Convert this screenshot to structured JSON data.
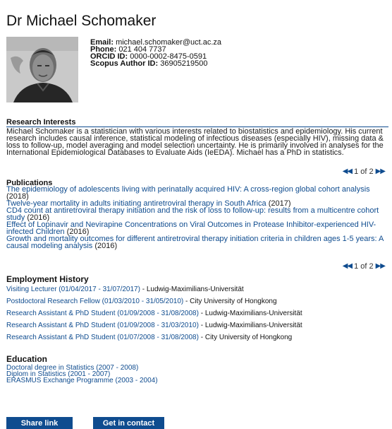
{
  "profile": {
    "name": "Dr Michael Schomaker",
    "email_label": "Email:",
    "email": "michael.schomaker@uct.ac.za",
    "phone_label": "Phone:",
    "phone": "021 404 7737",
    "orcid_label": "ORCID ID:",
    "orcid": "0000-0002-8475-0591",
    "scopus_label": "Scopus Author ID:",
    "scopus": "36905219500"
  },
  "research": {
    "title": "Research Interests",
    "text": "Michael Schomaker is a statistician with various interests related to biostatistics and epidemiology. His current research includes causal inference, statistical modeling of infectious diseases (especially HIV), missing data & loss to follow-up, model averaging and model selection uncertainty. He is primarily involved in analyses for the International Epidemiological Databases to Evaluate Aids (IeEDA). Michael has a PhD in statistics."
  },
  "pager1": {
    "text": "1 of 2"
  },
  "publications": {
    "title": "Publications",
    "items": [
      {
        "title": "The epidemiology of adolescents living with perinatally acquired HIV: A cross-region global cohort analysis",
        "year": "(2018)"
      },
      {
        "title": "Twelve-year mortality in adults initiating antiretroviral therapy in South Africa",
        "year": "(2017)"
      },
      {
        "title": "CD4 count at antiretroviral therapy initiation and the risk of loss to follow-up: results from a multicentre cohort study",
        "year": "(2016)"
      },
      {
        "title": "Effect of Lopinavir and Nevirapine Concentrations on Viral Outcomes in Protease Inhibitor-experienced HIV-infected Children",
        "year": "(2016)"
      },
      {
        "title": "Growth and mortality outcomes for different antiretroviral therapy initiation criteria in children ages 1-5 years: A causal modeling analysis",
        "year": "(2016)"
      }
    ]
  },
  "pager2": {
    "text": "1 of 2"
  },
  "employment": {
    "title": "Employment History",
    "items": [
      {
        "role": "Visiting Lecturer (01/04/2017 - 31/07/2017)",
        "org": "Ludwig-Maximilians-Universität"
      },
      {
        "role": "Postdoctoral Research Fellow (01/03/2010 - 31/05/2010)",
        "org": "City University of Hongkong"
      },
      {
        "role": "Research Assistant & PhD Student (01/09/2008 - 31/08/2008)",
        "org": "Ludwig-Maximilians-Universität"
      },
      {
        "role": "Research Assistant & PhD Student (01/09/2008 - 31/03/2010)",
        "org": "Ludwig-Maximilians-Universität"
      },
      {
        "role": "Research Assistant & PhD Student (01/07/2008 - 31/08/2008)",
        "org": "City University of Hongkong"
      }
    ]
  },
  "education": {
    "title": "Education",
    "items": [
      "Doctoral degree in Statistics (2007 - 2008)",
      "Diplom in Statistics (2001 - 2007)",
      "ERASMUS Exchange Programme (2003 - 2004)"
    ]
  },
  "actions": {
    "share": "Share link",
    "contact": "Get in contact"
  },
  "colors": {
    "accent": "#0f4c8f"
  }
}
